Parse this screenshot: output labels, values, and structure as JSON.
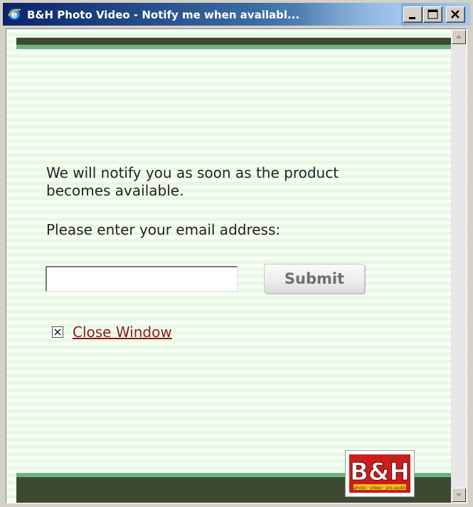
{
  "window": {
    "title": "B&H Photo Video - Notify me when availabl..."
  },
  "content": {
    "message_line1": "We will notify you as soon as the product",
    "message_line2": "becomes available.",
    "email_prompt": "Please enter your email address:",
    "email_value": "",
    "email_placeholder": "",
    "submit_label": "Submit",
    "close_link_label": "Close Window"
  },
  "logo": {
    "text": "B&H",
    "tagline": "photo · video · pro audio"
  },
  "colors": {
    "band_dark": "#3d4a33",
    "band_green": "#6fb37c",
    "stripe_light": "#f6fff4",
    "stripe_dark": "#e9f7e5",
    "link_red": "#8b1a1a",
    "logo_red": "#c81e1e",
    "title_gradient_start": "#0a246a"
  },
  "icons": {
    "title": "internet-explorer-icon",
    "minimize": "minimize-icon",
    "maximize": "maximize-icon",
    "close": "close-icon",
    "close_link": "boxed-x-icon",
    "scroll_up": "arrow-up-icon",
    "scroll_down": "arrow-down-icon"
  }
}
